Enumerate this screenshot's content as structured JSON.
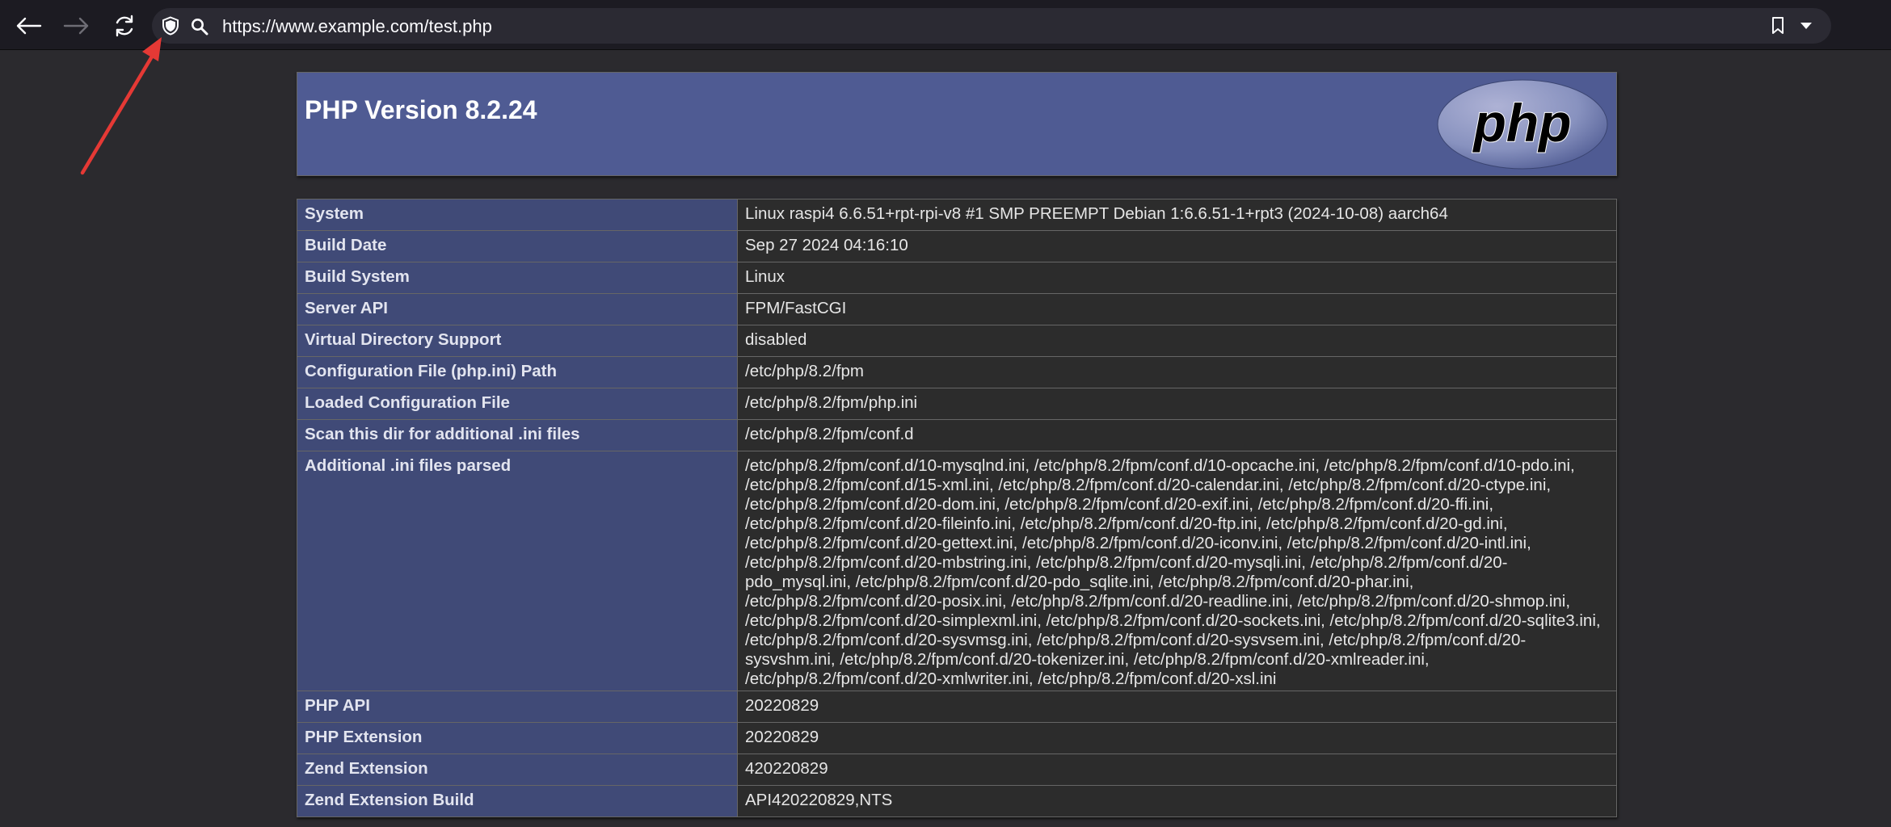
{
  "browser": {
    "url": "https://www.example.com/test.php",
    "icons": {
      "back": "arrow-left-icon",
      "forward": "arrow-right-icon",
      "reload": "reload-icon",
      "tracking_protection": "shield-icon",
      "search": "search-icon",
      "bookmark": "bookmark-icon",
      "dropdown": "chevron-down-icon"
    }
  },
  "annotation": {
    "color": "#e53935",
    "target": "shield-icon"
  },
  "phpinfo": {
    "title": "PHP Version 8.2.24",
    "logo_text": "php",
    "colors": {
      "header_bg": "#4f5b93",
      "key_bg": "#404a77",
      "value_bg": "#2c2c2c"
    },
    "rows": [
      {
        "key": "System",
        "value": "Linux raspi4 6.6.51+rpt-rpi-v8 #1 SMP PREEMPT Debian 1:6.6.51-1+rpt3 (2024-10-08) aarch64"
      },
      {
        "key": "Build Date",
        "value": "Sep 27 2024 04:16:10"
      },
      {
        "key": "Build System",
        "value": "Linux"
      },
      {
        "key": "Server API",
        "value": "FPM/FastCGI"
      },
      {
        "key": "Virtual Directory Support",
        "value": "disabled"
      },
      {
        "key": "Configuration File (php.ini) Path",
        "value": "/etc/php/8.2/fpm"
      },
      {
        "key": "Loaded Configuration File",
        "value": "/etc/php/8.2/fpm/php.ini"
      },
      {
        "key": "Scan this dir for additional .ini files",
        "value": "/etc/php/8.2/fpm/conf.d"
      },
      {
        "key": "Additional .ini files parsed",
        "value": "/etc/php/8.2/fpm/conf.d/10-mysqlnd.ini, /etc/php/8.2/fpm/conf.d/10-opcache.ini, /etc/php/8.2/fpm/conf.d/10-pdo.ini, /etc/php/8.2/fpm/conf.d/15-xml.ini, /etc/php/8.2/fpm/conf.d/20-calendar.ini, /etc/php/8.2/fpm/conf.d/20-ctype.ini, /etc/php/8.2/fpm/conf.d/20-dom.ini, /etc/php/8.2/fpm/conf.d/20-exif.ini, /etc/php/8.2/fpm/conf.d/20-ffi.ini, /etc/php/8.2/fpm/conf.d/20-fileinfo.ini, /etc/php/8.2/fpm/conf.d/20-ftp.ini, /etc/php/8.2/fpm/conf.d/20-gd.ini, /etc/php/8.2/fpm/conf.d/20-gettext.ini, /etc/php/8.2/fpm/conf.d/20-iconv.ini, /etc/php/8.2/fpm/conf.d/20-intl.ini, /etc/php/8.2/fpm/conf.d/20-mbstring.ini, /etc/php/8.2/fpm/conf.d/20-mysqli.ini, /etc/php/8.2/fpm/conf.d/20-pdo_mysql.ini, /etc/php/8.2/fpm/conf.d/20-pdo_sqlite.ini, /etc/php/8.2/fpm/conf.d/20-phar.ini, /etc/php/8.2/fpm/conf.d/20-posix.ini, /etc/php/8.2/fpm/conf.d/20-readline.ini, /etc/php/8.2/fpm/conf.d/20-shmop.ini, /etc/php/8.2/fpm/conf.d/20-simplexml.ini, /etc/php/8.2/fpm/conf.d/20-sockets.ini, /etc/php/8.2/fpm/conf.d/20-sqlite3.ini, /etc/php/8.2/fpm/conf.d/20-sysvmsg.ini, /etc/php/8.2/fpm/conf.d/20-sysvsem.ini, /etc/php/8.2/fpm/conf.d/20-sysvshm.ini, /etc/php/8.2/fpm/conf.d/20-tokenizer.ini, /etc/php/8.2/fpm/conf.d/20-xmlreader.ini, /etc/php/8.2/fpm/conf.d/20-xmlwriter.ini, /etc/php/8.2/fpm/conf.d/20-xsl.ini"
      },
      {
        "key": "PHP API",
        "value": "20220829"
      },
      {
        "key": "PHP Extension",
        "value": "20220829"
      },
      {
        "key": "Zend Extension",
        "value": "420220829"
      },
      {
        "key": "Zend Extension Build",
        "value": "API420220829,NTS"
      }
    ]
  }
}
